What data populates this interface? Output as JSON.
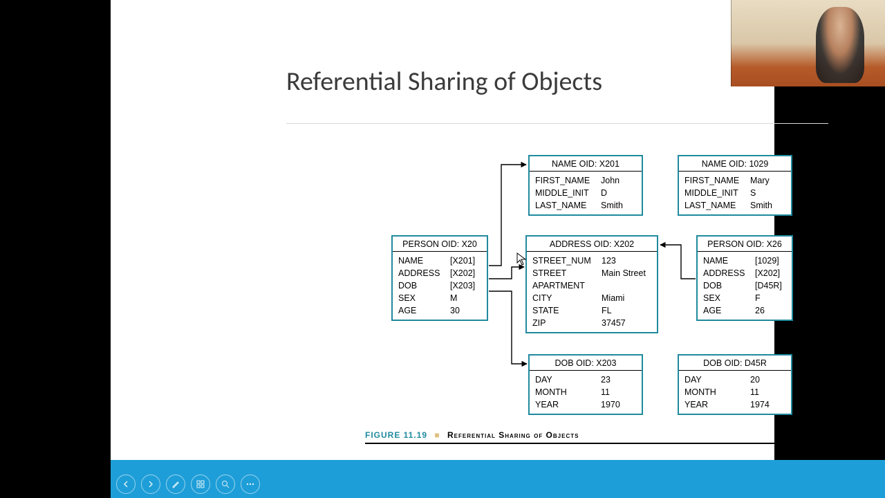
{
  "title": "Referential Sharing of Objects",
  "figure": {
    "number": "FIGURE 11.19",
    "title": "Referential Sharing of Objects"
  },
  "boxes": {
    "nameX201": {
      "header": "NAME OID: X201",
      "rows": [
        {
          "k": "FIRST_NAME",
          "v": "John"
        },
        {
          "k": "MIDDLE_INIT",
          "v": "D"
        },
        {
          "k": "LAST_NAME",
          "v": "Smith"
        }
      ]
    },
    "name1029": {
      "header": "NAME OID: 1029",
      "rows": [
        {
          "k": "FIRST_NAME",
          "v": "Mary"
        },
        {
          "k": "MIDDLE_INIT",
          "v": "S"
        },
        {
          "k": "LAST_NAME",
          "v": "Smith"
        }
      ]
    },
    "personX20": {
      "header": "PERSON OID: X20",
      "rows": [
        {
          "k": "NAME",
          "v": "[X201]"
        },
        {
          "k": "ADDRESS",
          "v": "[X202]"
        },
        {
          "k": "DOB",
          "v": "[X203]"
        },
        {
          "k": "SEX",
          "v": "M"
        },
        {
          "k": "AGE",
          "v": "30"
        }
      ]
    },
    "addressX202": {
      "header": "ADDRESS OID: X202",
      "rows": [
        {
          "k": "STREET_NUM",
          "v": "123"
        },
        {
          "k": "STREET",
          "v": "Main Street"
        },
        {
          "k": "APARTMENT",
          "v": ""
        },
        {
          "k": "CITY",
          "v": "Miami"
        },
        {
          "k": "STATE",
          "v": "FL"
        },
        {
          "k": "ZIP",
          "v": "37457"
        }
      ]
    },
    "personX26": {
      "header": "PERSON OID: X26",
      "rows": [
        {
          "k": "NAME",
          "v": "[1029]"
        },
        {
          "k": "ADDRESS",
          "v": "[X202]"
        },
        {
          "k": "DOB",
          "v": "[D45R]"
        },
        {
          "k": "SEX",
          "v": "F"
        },
        {
          "k": "AGE",
          "v": "26"
        }
      ]
    },
    "dobX203": {
      "header": "DOB OID: X203",
      "rows": [
        {
          "k": "DAY",
          "v": "23"
        },
        {
          "k": "MONTH",
          "v": "11"
        },
        {
          "k": "YEAR",
          "v": "1970"
        }
      ]
    },
    "dobD45R": {
      "header": "DOB OID: D45R",
      "rows": [
        {
          "k": "DAY",
          "v": "20"
        },
        {
          "k": "MONTH",
          "v": "11"
        },
        {
          "k": "YEAR",
          "v": "1974"
        }
      ]
    }
  },
  "toolbar": {
    "prev": "prev",
    "next": "next",
    "pen": "pen",
    "crop": "crop",
    "zoom": "zoom",
    "more": "more"
  }
}
